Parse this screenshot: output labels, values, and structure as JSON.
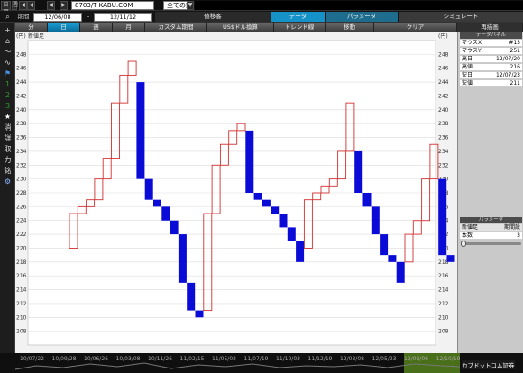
{
  "toolbar": {
    "left_labels": [
      "日足",
      "週"
    ],
    "symbol": "8703/T KABU.COM",
    "scope": "全ての銘柄",
    "scope_caret": "▼",
    "nav_first": "◀",
    "nav_prev": "◀",
    "nav_next": "▶"
  },
  "daterow": {
    "period_label": "期間",
    "from_date": "12/06/08",
    "sep": "-",
    "to_date": "12/11/12",
    "tab_sub": "値移客",
    "tab_data": "データ",
    "tab_param": "パラメータ",
    "tab_sim": "シミュレート"
  },
  "chart_toolbar": {
    "buttons": [
      "分",
      "日",
      "週",
      "月",
      "カスタム期間",
      "US$ドル換算",
      "トレンド線",
      "移動",
      "クリア",
      "再描画"
    ],
    "selected": "日",
    "new_label": "新値足"
  },
  "leftbar": {
    "icons": [
      {
        "name": "search-icon",
        "glyph": "🔍"
      },
      {
        "name": "crosshair-icon",
        "glyph": "+"
      },
      {
        "name": "building-icon",
        "glyph": "⌂"
      },
      {
        "name": "chart-line-icon",
        "glyph": "〜"
      },
      {
        "name": "chart-area-icon",
        "glyph": "∿"
      },
      {
        "name": "flag-icon",
        "glyph": "⚑"
      },
      {
        "name": "number-1-icon",
        "glyph": "1"
      },
      {
        "name": "number-2-icon",
        "glyph": "2"
      },
      {
        "name": "number-3-icon",
        "glyph": "3"
      },
      {
        "name": "star-icon",
        "glyph": "★"
      },
      {
        "name": "kanji-ke-icon",
        "glyph": "消"
      },
      {
        "name": "kanji-shou-icon",
        "glyph": "詳"
      },
      {
        "name": "kanji-shu-icon",
        "glyph": "取"
      },
      {
        "name": "kanji-ryoku-icon",
        "glyph": "力"
      },
      {
        "name": "kanji-mei-icon",
        "glyph": "銘"
      },
      {
        "name": "gear-icon",
        "glyph": "⚙"
      }
    ]
  },
  "right_panel": {
    "data_header": "データパネル",
    "rows": [
      {
        "k": "マウスX",
        "v": "#13"
      },
      {
        "k": "マウスY",
        "v": "251"
      },
      {
        "k": "高日",
        "v": "12/07/20"
      },
      {
        "k": "高値",
        "v": "216"
      },
      {
        "k": "安日",
        "v": "12/07/23"
      },
      {
        "k": "安値",
        "v": "211"
      }
    ],
    "param_header": "パラメータ",
    "param_cols": [
      "新値足",
      "期間設"
    ],
    "param_row": {
      "k": "本数",
      "v": "3"
    }
  },
  "timeline": {
    "labels": [
      "10/07/22",
      "10/09/28",
      "10/06/26",
      "10/03/08",
      "10/11/26",
      "11/02/15",
      "11/05/02",
      "11/07/19",
      "11/10/03",
      "11/12/19",
      "12/03/08",
      "12/05/23",
      "12/08/06",
      "12/10/19"
    ],
    "brand": "カブドットコム証券"
  },
  "chart_data": {
    "type": "kagi-new-price-bars",
    "ylabel": "(円)",
    "ylim": [
      206,
      250
    ],
    "yticks": [
      208,
      210,
      212,
      214,
      216,
      218,
      220,
      222,
      224,
      226,
      228,
      230,
      232,
      234,
      236,
      238,
      240,
      242,
      244,
      246,
      248
    ],
    "bars": [
      {
        "dir": "up",
        "open": 220,
        "close": 225
      },
      {
        "dir": "up",
        "open": 225,
        "close": 226
      },
      {
        "dir": "up",
        "open": 226,
        "close": 227
      },
      {
        "dir": "up",
        "open": 227,
        "close": 230
      },
      {
        "dir": "up",
        "open": 230,
        "close": 233
      },
      {
        "dir": "up",
        "open": 233,
        "close": 241
      },
      {
        "dir": "up",
        "open": 241,
        "close": 245
      },
      {
        "dir": "up",
        "open": 245,
        "close": 247
      },
      {
        "dir": "down",
        "open": 244,
        "close": 230
      },
      {
        "dir": "down",
        "open": 230,
        "close": 227
      },
      {
        "dir": "down",
        "open": 227,
        "close": 226
      },
      {
        "dir": "down",
        "open": 226,
        "close": 224
      },
      {
        "dir": "down",
        "open": 224,
        "close": 222
      },
      {
        "dir": "down",
        "open": 222,
        "close": 215
      },
      {
        "dir": "down",
        "open": 215,
        "close": 211
      },
      {
        "dir": "down",
        "open": 211,
        "close": 210
      },
      {
        "dir": "up",
        "open": 211,
        "close": 225
      },
      {
        "dir": "up",
        "open": 225,
        "close": 232
      },
      {
        "dir": "up",
        "open": 232,
        "close": 235
      },
      {
        "dir": "up",
        "open": 235,
        "close": 237
      },
      {
        "dir": "up",
        "open": 237,
        "close": 238
      },
      {
        "dir": "down",
        "open": 237,
        "close": 228
      },
      {
        "dir": "down",
        "open": 228,
        "close": 227
      },
      {
        "dir": "down",
        "open": 227,
        "close": 226
      },
      {
        "dir": "down",
        "open": 226,
        "close": 225
      },
      {
        "dir": "down",
        "open": 225,
        "close": 223
      },
      {
        "dir": "down",
        "open": 223,
        "close": 221
      },
      {
        "dir": "down",
        "open": 221,
        "close": 218
      },
      {
        "dir": "up",
        "open": 220,
        "close": 227
      },
      {
        "dir": "up",
        "open": 227,
        "close": 228
      },
      {
        "dir": "up",
        "open": 228,
        "close": 229
      },
      {
        "dir": "up",
        "open": 229,
        "close": 230
      },
      {
        "dir": "up",
        "open": 230,
        "close": 234
      },
      {
        "dir": "up",
        "open": 234,
        "close": 241
      },
      {
        "dir": "down",
        "open": 234,
        "close": 228
      },
      {
        "dir": "down",
        "open": 228,
        "close": 226
      },
      {
        "dir": "down",
        "open": 226,
        "close": 222
      },
      {
        "dir": "down",
        "open": 222,
        "close": 219
      },
      {
        "dir": "down",
        "open": 219,
        "close": 218
      },
      {
        "dir": "down",
        "open": 218,
        "close": 215
      },
      {
        "dir": "up",
        "open": 218,
        "close": 222
      },
      {
        "dir": "up",
        "open": 222,
        "close": 224
      },
      {
        "dir": "up",
        "open": 224,
        "close": 230
      },
      {
        "dir": "up",
        "open": 230,
        "close": 235
      },
      {
        "dir": "down",
        "open": 230,
        "close": 219
      },
      {
        "dir": "down",
        "open": 219,
        "close": 218
      }
    ]
  }
}
